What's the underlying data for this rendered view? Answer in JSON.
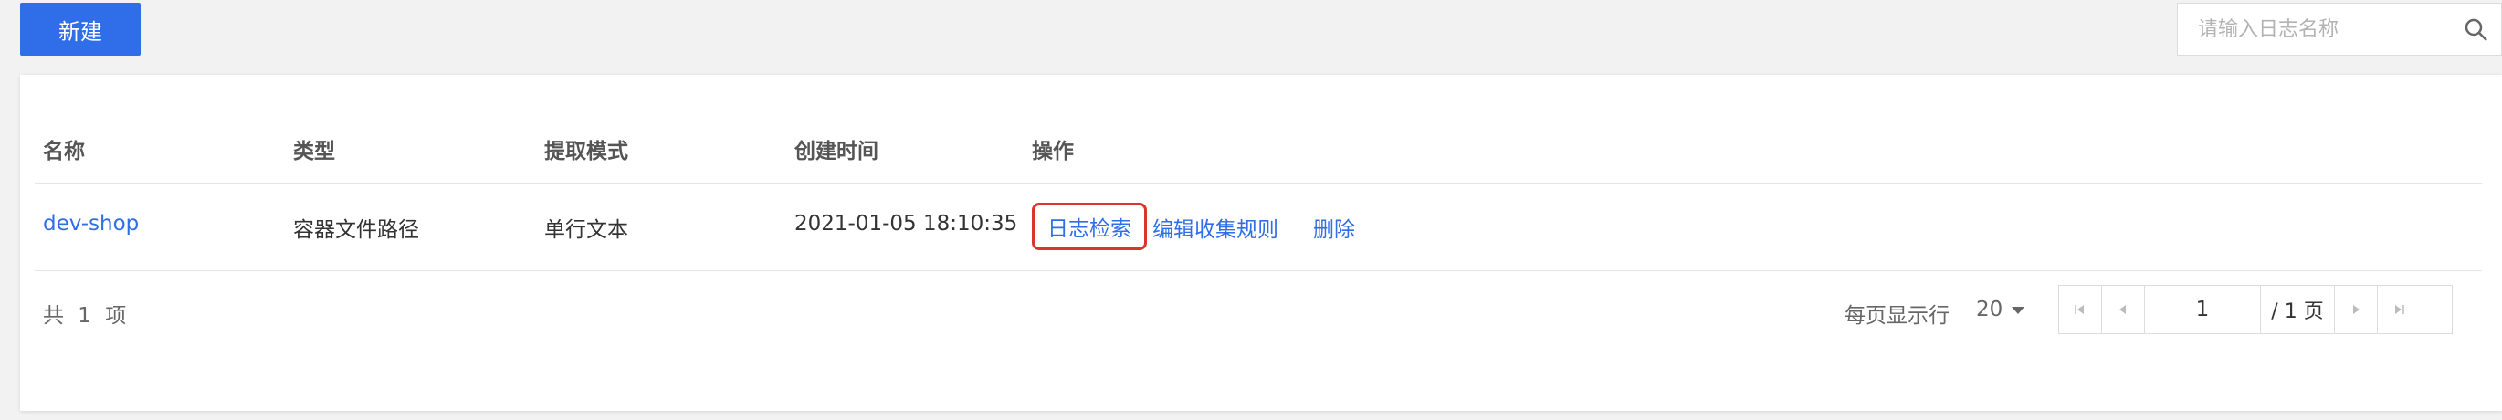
{
  "toolbar": {
    "new_label": "新建"
  },
  "search": {
    "placeholder": "请输入日志名称",
    "value": "",
    "icon": "search-icon"
  },
  "table": {
    "columns": [
      "名称",
      "类型",
      "提取模式",
      "创建时间",
      "操作"
    ],
    "rows": [
      {
        "name": "dev-shop",
        "type": "容器文件路径",
        "mode": "单行文本",
        "created": "2021-01-05 18:10:35",
        "actions": [
          "日志检索",
          "编辑收集规则",
          "删除"
        ]
      }
    ]
  },
  "footer": {
    "total": "共 1 项",
    "per_page_label": "每页显示行",
    "per_page_value": "20",
    "current_page": "1",
    "total_pages": "/ 1 页"
  },
  "colors": {
    "accent": "#2f6ee8",
    "highlight": "#d8362b"
  }
}
